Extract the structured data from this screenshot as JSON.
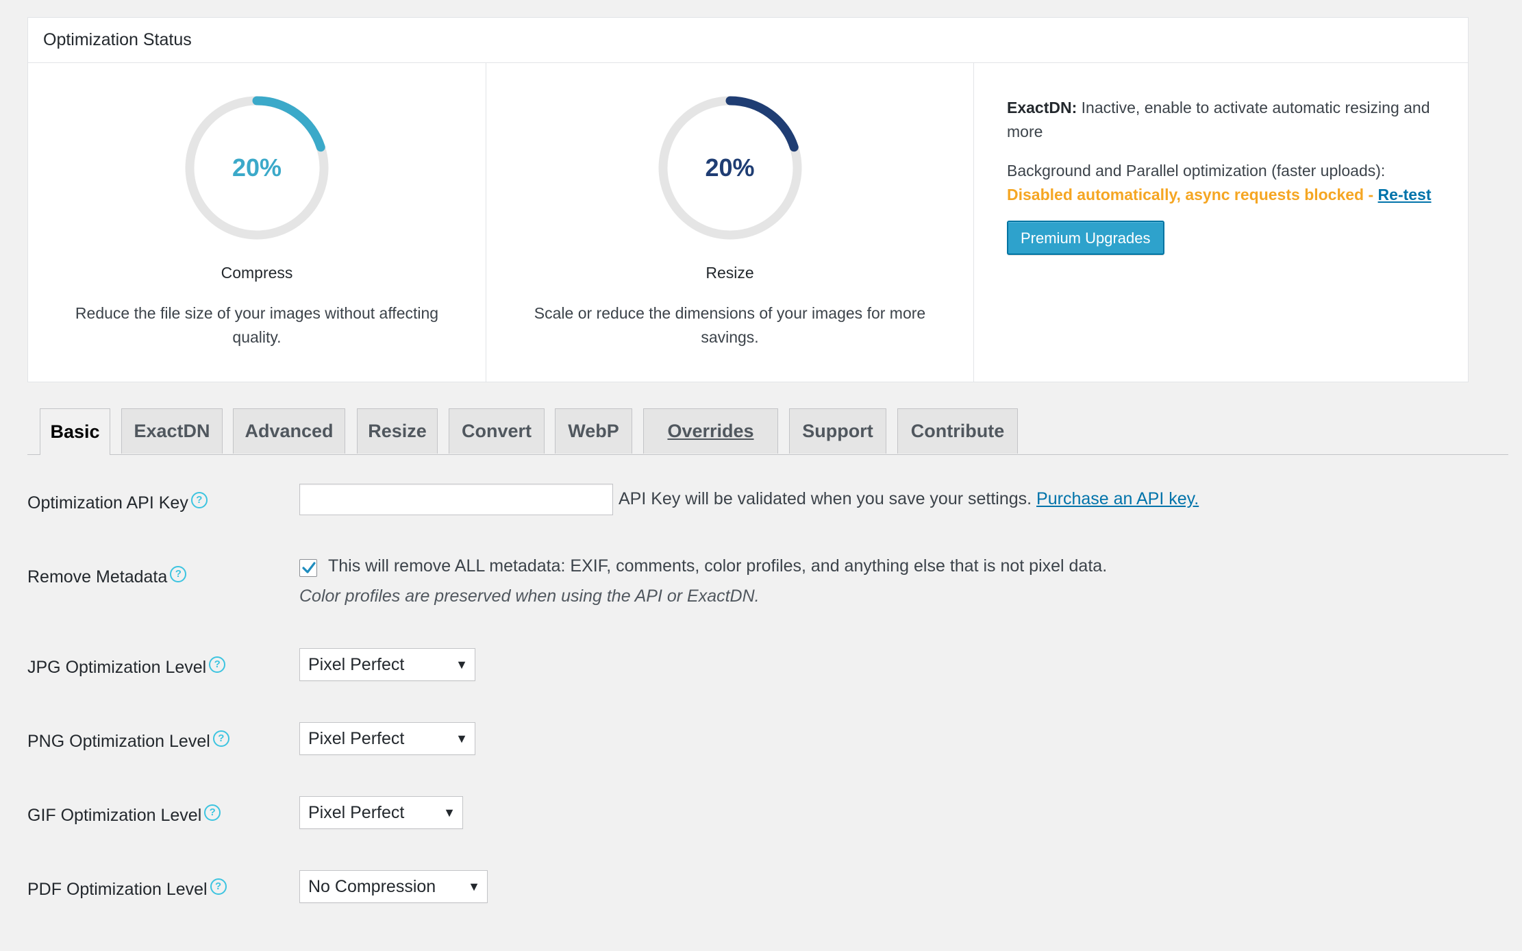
{
  "status": {
    "title": "Optimization Status",
    "compress": {
      "percent_label": "20%",
      "fraction": 0.2,
      "title": "Compress",
      "description": "Reduce the file size of your images without affecting quality.",
      "color": "#3ba9c9"
    },
    "resize": {
      "percent_label": "20%",
      "fraction": 0.2,
      "title": "Resize",
      "description": "Scale or reduce the dimensions of your images for more savings.",
      "color": "#1f3d73"
    },
    "exactdn_label": "ExactDN:",
    "exactdn_text": "Inactive, enable to activate automatic resizing and more",
    "background_label": "Background and Parallel optimization (faster uploads):",
    "warning_text": "Disabled automatically, async requests blocked - ",
    "retest_link": "Re-test",
    "premium_button": "Premium Upgrades"
  },
  "tabs": [
    {
      "label": "Basic"
    },
    {
      "label": "ExactDN"
    },
    {
      "label": "Advanced"
    },
    {
      "label": "Resize"
    },
    {
      "label": "Convert"
    },
    {
      "label": "WebP"
    },
    {
      "label": "Overrides"
    },
    {
      "label": "Support"
    },
    {
      "label": "Contribute"
    }
  ],
  "form": {
    "api_key": {
      "label": "Optimization API Key",
      "value": "",
      "note": "API Key will be validated when you save your settings. ",
      "purchase_link": "Purchase an API key."
    },
    "metadata": {
      "label": "Remove Metadata",
      "checked": true,
      "text": "This will remove ALL metadata: EXIF, comments, color profiles, and anything else that is not pixel data.",
      "note": "Color profiles are preserved when using the API or ExactDN."
    },
    "jpg": {
      "label": "JPG Optimization Level",
      "value": "Pixel Perfect"
    },
    "png": {
      "label": "PNG Optimization Level",
      "value": "Pixel Perfect"
    },
    "gif": {
      "label": "GIF Optimization Level",
      "value": "Pixel Perfect"
    },
    "pdf": {
      "label": "PDF Optimization Level",
      "value": "No Compression"
    },
    "help_glyph": "?",
    "dropdown_glyph": "▼"
  }
}
